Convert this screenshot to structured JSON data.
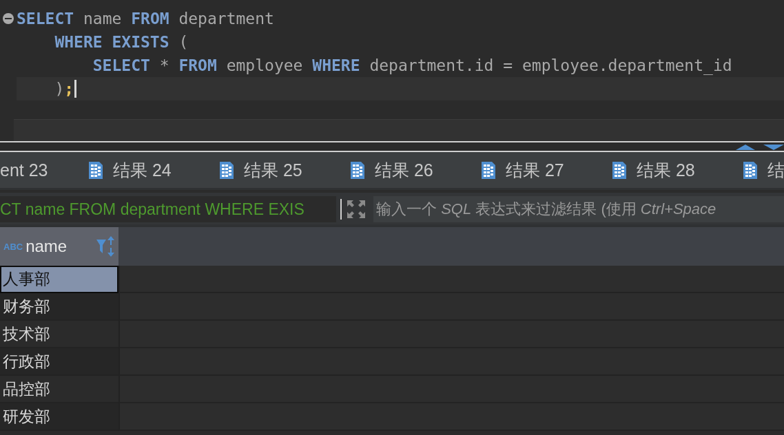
{
  "editor": {
    "lines": [
      {
        "folding": true,
        "current": false,
        "tokens": [
          {
            "kind": "keyword",
            "text": "SELECT"
          },
          {
            "kind": "ident",
            "text": " name "
          },
          {
            "kind": "keyword",
            "text": "FROM"
          },
          {
            "kind": "ident",
            "text": " department"
          }
        ]
      },
      {
        "folding": false,
        "current": false,
        "tokens": [
          {
            "kind": "keyword",
            "text": "    WHERE EXISTS"
          },
          {
            "kind": "ident",
            "text": " ("
          }
        ]
      },
      {
        "folding": false,
        "current": false,
        "tokens": [
          {
            "kind": "keyword",
            "text": "        SELECT"
          },
          {
            "kind": "ident",
            "text": " * "
          },
          {
            "kind": "keyword",
            "text": "FROM"
          },
          {
            "kind": "ident",
            "text": " employee "
          },
          {
            "kind": "keyword",
            "text": "WHERE"
          },
          {
            "kind": "ident",
            "text": " department.id = employee.department_id"
          }
        ]
      },
      {
        "folding": false,
        "current": true,
        "tokens": [
          {
            "kind": "ident",
            "text": "    )"
          },
          {
            "kind": "semicolon",
            "text": ";"
          }
        ]
      }
    ]
  },
  "result_tabs": [
    {
      "label": "ent 23",
      "selected": false
    },
    {
      "label": "结果 24",
      "selected": false
    },
    {
      "label": "结果 25",
      "selected": false
    },
    {
      "label": "结果 26",
      "selected": false
    },
    {
      "label": "结果 27",
      "selected": false
    },
    {
      "label": "结果 28",
      "selected": false
    },
    {
      "label": "结",
      "selected": false
    }
  ],
  "filter": {
    "query": "CT name FROM department WHERE EXIS",
    "placeholder": "输入一个 *SQL* 表达式来过滤结果 (使用 *Ctrl+Space*"
  },
  "table": {
    "columns": [
      {
        "type_label": "ABC",
        "name": "name"
      }
    ],
    "rows": [
      {
        "name": "人事部",
        "selected": true
      },
      {
        "name": "财务部",
        "selected": false
      },
      {
        "name": "技术部",
        "selected": false
      },
      {
        "name": "行政部",
        "selected": false
      },
      {
        "name": "品控部",
        "selected": false
      },
      {
        "name": "研发部",
        "selected": false
      }
    ]
  }
}
